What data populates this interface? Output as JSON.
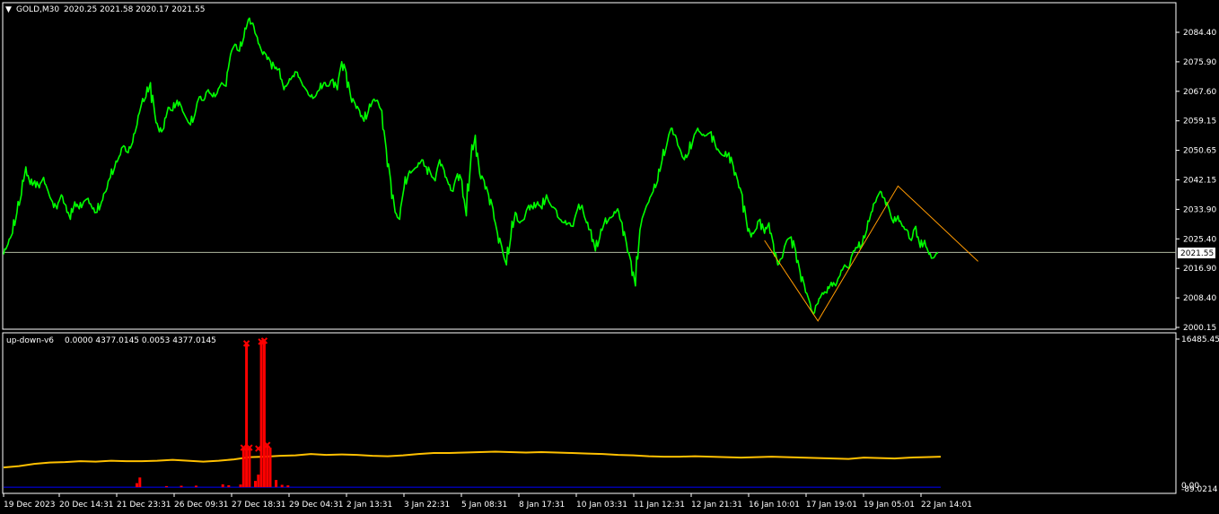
{
  "colors": {
    "background": "#000000",
    "frame": "#ffffff",
    "price_line": "#00ff00",
    "zigzag": "#ff9900",
    "indicator_line": "#ffc000",
    "histogram": "#ff0000",
    "baseline": "#0000ff",
    "current_price_line": "#b0b8a0"
  },
  "main_panel": {
    "header_arrow": "▼",
    "symbol": "GOLD,M30",
    "ohlc": "2020.25 2021.58 2020.17 2021.55",
    "current_price_label": "2021.55"
  },
  "sub_panel": {
    "indicator_name": "up-down-v6",
    "values": "0.0000 4377.0145 0.0053 4377.0145",
    "top_label": "16485.450",
    "bottom_label": "0.00",
    "bottom_label_2": "-89.0214"
  },
  "chart_data": [
    {
      "type": "line",
      "title": "GOLD,M30",
      "y_ticks": [
        "2084.40",
        "2075.90",
        "2067.60",
        "2059.15",
        "2050.65",
        "2042.15",
        "2033.90",
        "2025.40",
        "2016.90",
        "2008.40",
        "2000.15"
      ],
      "x_ticks": [
        "19 Dec 2023",
        "20 Dec 14:31",
        "21 Dec 23:31",
        "26 Dec 09:31",
        "27 Dec 18:31",
        "29 Dec 04:31",
        "2 Jan 13:31",
        "3 Jan 22:31",
        "5 Jan 08:31",
        "8 Jan 17:31",
        "10 Jan 03:31",
        "11 Jan 12:31",
        "12 Jan 21:31",
        "16 Jan 10:01",
        "17 Jan 19:01",
        "19 Jan 05:01",
        "22 Jan 14:01"
      ],
      "ylim": [
        1999,
        2090
      ],
      "current_price": 2021.55,
      "series": [
        {
          "values": [
            2021,
            2024,
            2027,
            2033,
            2038,
            2046,
            2041,
            2042,
            2040,
            2043,
            2039,
            2036,
            2034,
            2038,
            2035,
            2031,
            2036,
            2034,
            2036,
            2037,
            2034,
            2033,
            2036,
            2039,
            2043,
            2046,
            2049,
            2052,
            2050,
            2053,
            2058,
            2064,
            2066,
            2070,
            2061,
            2056,
            2057,
            2063,
            2062,
            2065,
            2063,
            2060,
            2058,
            2061,
            2066,
            2065,
            2068,
            2066,
            2067,
            2070,
            2069,
            2078,
            2081,
            2079,
            2083,
            2088,
            2087,
            2083,
            2079,
            2078,
            2076,
            2074,
            2074,
            2068,
            2070,
            2072,
            2073,
            2070,
            2068,
            2066,
            2066,
            2068,
            2070,
            2069,
            2071,
            2068,
            2076,
            2073,
            2066,
            2064,
            2062,
            2059,
            2062,
            2065,
            2065,
            2062,
            2051,
            2042,
            2033,
            2031,
            2040,
            2044,
            2045,
            2046,
            2048,
            2046,
            2044,
            2042,
            2048,
            2045,
            2041,
            2039,
            2044,
            2042,
            2032,
            2048,
            2055,
            2044,
            2042,
            2038,
            2034,
            2027,
            2023,
            2018,
            2026,
            2033,
            2030,
            2031,
            2035,
            2034,
            2036,
            2034,
            2038,
            2035,
            2034,
            2031,
            2030,
            2030,
            2029,
            2034,
            2035,
            2030,
            2028,
            2022,
            2026,
            2030,
            2031,
            2032,
            2034,
            2030,
            2024,
            2019,
            2012,
            2028,
            2033,
            2036,
            2039,
            2042,
            2048,
            2052,
            2057,
            2055,
            2051,
            2048,
            2050,
            2054,
            2057,
            2055,
            2055,
            2056,
            2052,
            2050,
            2049,
            2050,
            2046,
            2042,
            2038,
            2030,
            2026,
            2028,
            2031,
            2027,
            2030,
            2024,
            2018,
            2020,
            2025,
            2026,
            2022,
            2016,
            2012,
            2008,
            2004,
            2007,
            2010,
            2010,
            2013,
            2012,
            2015,
            2018,
            2017,
            2022,
            2023,
            2024,
            2028,
            2033,
            2036,
            2039,
            2037,
            2034,
            2030,
            2032,
            2029,
            2028,
            2025,
            2029,
            2023,
            2025,
            2021,
            2020,
            2021.55
          ]
        },
        {
          "name": "zigzag",
          "type": "line",
          "points": [
            {
              "i": 171,
              "v": 2025.0
            },
            {
              "i": 183,
              "v": 2002.0
            },
            {
              "i": 201,
              "v": 2040.5
            },
            {
              "i": 219,
              "v": 2019.0
            }
          ]
        }
      ]
    },
    {
      "type": "bar",
      "title": "up-down-v6",
      "ylim": [
        -89.0214,
        16485.45
      ],
      "histogram": [
        {
          "i": 45,
          "v": 450
        },
        {
          "i": 46,
          "v": 1080
        },
        {
          "i": 55,
          "v": 120
        },
        {
          "i": 60,
          "v": 160
        },
        {
          "i": 65,
          "v": 170
        },
        {
          "i": 74,
          "v": 320
        },
        {
          "i": 76,
          "v": 220
        },
        {
          "i": 80,
          "v": 300
        },
        {
          "i": 81,
          "v": 4400
        },
        {
          "i": 82,
          "v": 16000
        },
        {
          "i": 83,
          "v": 4400
        },
        {
          "i": 85,
          "v": 700
        },
        {
          "i": 86,
          "v": 1400
        },
        {
          "i": 87,
          "v": 16200
        },
        {
          "i": 88,
          "v": 16300
        },
        {
          "i": 89,
          "v": 4700
        },
        {
          "i": 90,
          "v": 4400
        },
        {
          "i": 92,
          "v": 800
        },
        {
          "i": 94,
          "v": 260
        },
        {
          "i": 96,
          "v": 200
        }
      ],
      "markers": [
        {
          "i": 82,
          "v": 16000
        },
        {
          "i": 87,
          "v": 16200
        },
        {
          "i": 88,
          "v": 16300
        },
        {
          "i": 81,
          "v": 4400
        },
        {
          "i": 83,
          "v": 4400
        },
        {
          "i": 86,
          "v": 4300
        },
        {
          "i": 89,
          "v": 4700
        }
      ],
      "yellow_line": [
        2200,
        2350,
        2600,
        2750,
        2800,
        2900,
        2850,
        2950,
        2900,
        2900,
        2950,
        3050,
        2950,
        2850,
        2950,
        3100,
        3350,
        3400,
        3500,
        3550,
        3700,
        3600,
        3650,
        3600,
        3500,
        3450,
        3550,
        3700,
        3800,
        3800,
        3850,
        3900,
        3950,
        3900,
        3850,
        3900,
        3850,
        3800,
        3750,
        3700,
        3600,
        3550,
        3450,
        3400,
        3400,
        3450,
        3400,
        3350,
        3300,
        3350,
        3400,
        3350,
        3300,
        3250,
        3200,
        3150,
        3300,
        3250,
        3200,
        3300,
        3350,
        3400
      ],
      "baseline": 0
    }
  ]
}
